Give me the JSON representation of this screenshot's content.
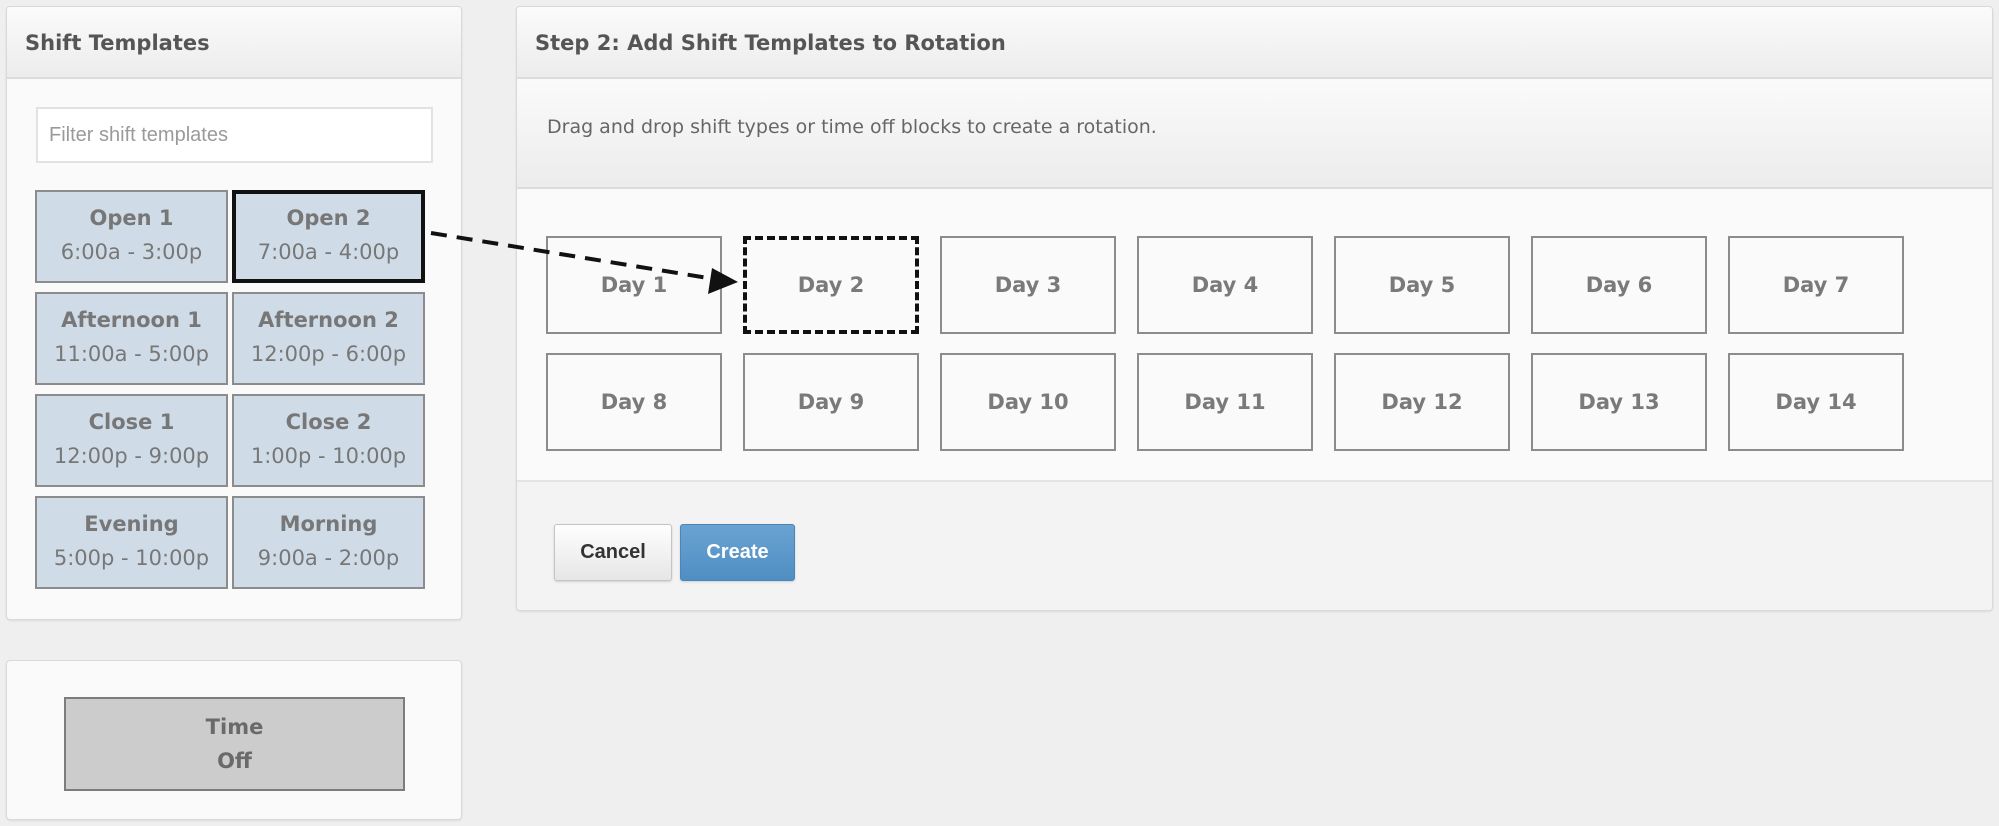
{
  "left_panel": {
    "title": "Shift Templates",
    "filter": {
      "placeholder": "Filter shift templates",
      "value": ""
    },
    "templates": [
      {
        "name": "Open 1",
        "time": "6:00a - 3:00p",
        "selected": false
      },
      {
        "name": "Open 2",
        "time": "7:00a - 4:00p",
        "selected": true
      },
      {
        "name": "Afternoon 1",
        "time": "11:00a - 5:00p",
        "selected": false
      },
      {
        "name": "Afternoon 2",
        "time": "12:00p - 6:00p",
        "selected": false
      },
      {
        "name": "Close 1",
        "time": "12:00p - 9:00p",
        "selected": false
      },
      {
        "name": "Close 2",
        "time": "1:00p - 10:00p",
        "selected": false
      },
      {
        "name": "Evening",
        "time": "5:00p - 10:00p",
        "selected": false
      },
      {
        "name": "Morning",
        "time": "9:00a - 2:00p",
        "selected": false
      }
    ]
  },
  "time_off": {
    "line1": "Time",
    "line2": "Off"
  },
  "right_panel": {
    "title": "Step 2: Add Shift Templates to Rotation",
    "description": "Drag and drop shift types or time off blocks to create a rotation.",
    "days": [
      "Day 1",
      "Day 2",
      "Day 3",
      "Day 4",
      "Day 5",
      "Day 6",
      "Day 7",
      "Day 8",
      "Day 9",
      "Day 10",
      "Day 11",
      "Day 12",
      "Day 13",
      "Day 14"
    ],
    "drop_target_day": "Day 2",
    "drag_source": "Open 2",
    "buttons": {
      "cancel": "Cancel",
      "create": "Create"
    }
  },
  "colors": {
    "template_bg": "#cfdce8",
    "time_off_bg": "#cccccc",
    "primary_button": "#5595c9"
  }
}
